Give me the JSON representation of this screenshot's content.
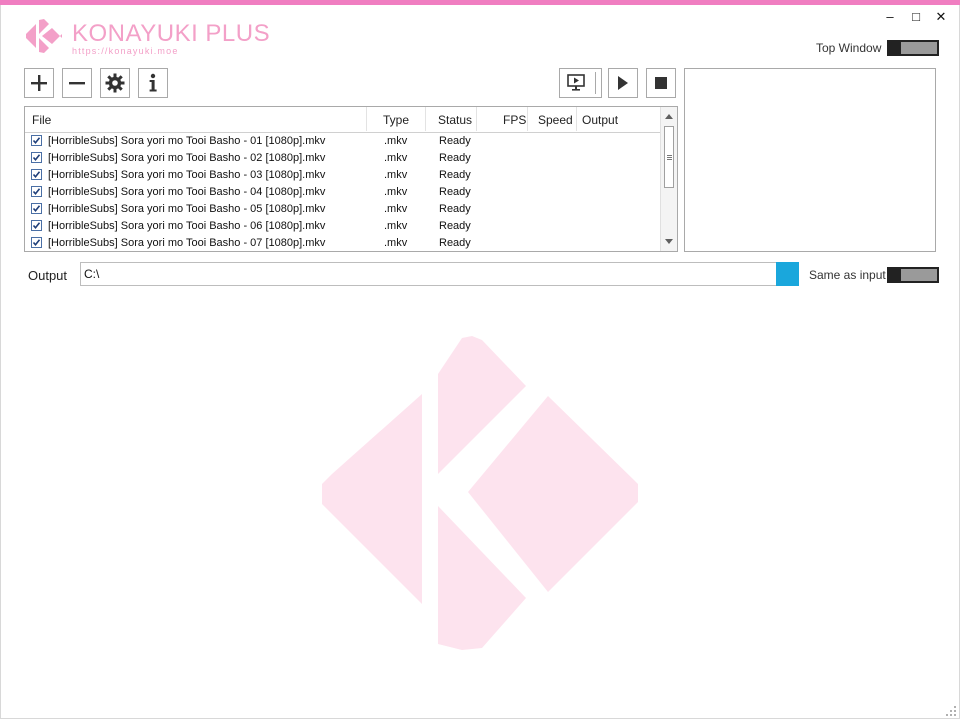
{
  "app": {
    "title": "KONAYUKI PLUS",
    "url": "https://konayuki.moe",
    "brand_color": "#f07ec1",
    "accent_color": "#1aa7dc"
  },
  "window_controls": {
    "minimize": "–",
    "maximize": "□",
    "close": "✕"
  },
  "top_window": {
    "label": "Top Window",
    "enabled": false
  },
  "toolbar": {
    "add_icon": "plus-icon",
    "remove_icon": "minus-icon",
    "settings_icon": "gear-icon",
    "info_icon": "info-icon",
    "preview_icon": "monitor-play-icon",
    "start_icon": "play-icon",
    "stop_icon": "stop-icon"
  },
  "file_list": {
    "columns": [
      "File",
      "Type",
      "Status",
      "FPS",
      "Speed",
      "Output"
    ],
    "rows": [
      {
        "checked": true,
        "file": "[HorribleSubs] Sora yori mo Tooi Basho - 01 [1080p].mkv",
        "type": ".mkv",
        "status": "Ready"
      },
      {
        "checked": true,
        "file": "[HorribleSubs] Sora yori mo Tooi Basho - 02 [1080p].mkv",
        "type": ".mkv",
        "status": "Ready"
      },
      {
        "checked": true,
        "file": "[HorribleSubs] Sora yori mo Tooi Basho - 03 [1080p].mkv",
        "type": ".mkv",
        "status": "Ready"
      },
      {
        "checked": true,
        "file": "[HorribleSubs] Sora yori mo Tooi Basho - 04 [1080p].mkv",
        "type": ".mkv",
        "status": "Ready"
      },
      {
        "checked": true,
        "file": "[HorribleSubs] Sora yori mo Tooi Basho - 05 [1080p].mkv",
        "type": ".mkv",
        "status": "Ready"
      },
      {
        "checked": true,
        "file": "[HorribleSubs] Sora yori mo Tooi Basho - 06 [1080p].mkv",
        "type": ".mkv",
        "status": "Ready"
      },
      {
        "checked": true,
        "file": "[HorribleSubs] Sora yori mo Tooi Basho - 07 [1080p].mkv",
        "type": ".mkv",
        "status": "Ready"
      }
    ]
  },
  "output": {
    "label": "Output",
    "path": "C:\\",
    "same_as_input_label": "Same as input",
    "same_as_input": false
  }
}
